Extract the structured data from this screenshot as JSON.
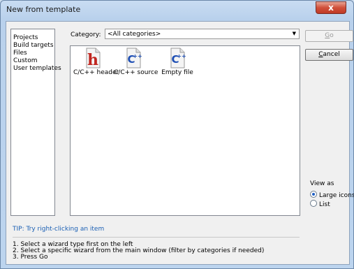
{
  "window": {
    "title": "New from template",
    "close_label": "x"
  },
  "categories_list": [
    "Projects",
    "Build targets",
    "Files",
    "Custom",
    "User templates"
  ],
  "category": {
    "label": "Category:",
    "selected": "<All categories>"
  },
  "templates": [
    {
      "label": "C/C++ header",
      "icon": "c-header-file-icon"
    },
    {
      "label": "C/C++ source",
      "icon": "c-source-file-icon"
    },
    {
      "label": "Empty file",
      "icon": "empty-file-icon"
    }
  ],
  "buttons": {
    "go_mnemonic": "G",
    "go_rest": "o",
    "cancel_mnemonic": "C",
    "cancel_rest": "ancel"
  },
  "view_as": {
    "label": "View as",
    "options": [
      "Large icons",
      "List"
    ],
    "selected": "Large icons"
  },
  "tip": "TIP: Try right-clicking an item",
  "instructions": [
    "1. Select a wizard type first on the left",
    "2. Select a specific wizard from the main window (filter by categories if needed)",
    "3. Press Go"
  ],
  "colors": {
    "tip_text": "#1a5fb4",
    "c_source_icon": "#1f4fb4",
    "c_header_icon": "#c0261f"
  }
}
